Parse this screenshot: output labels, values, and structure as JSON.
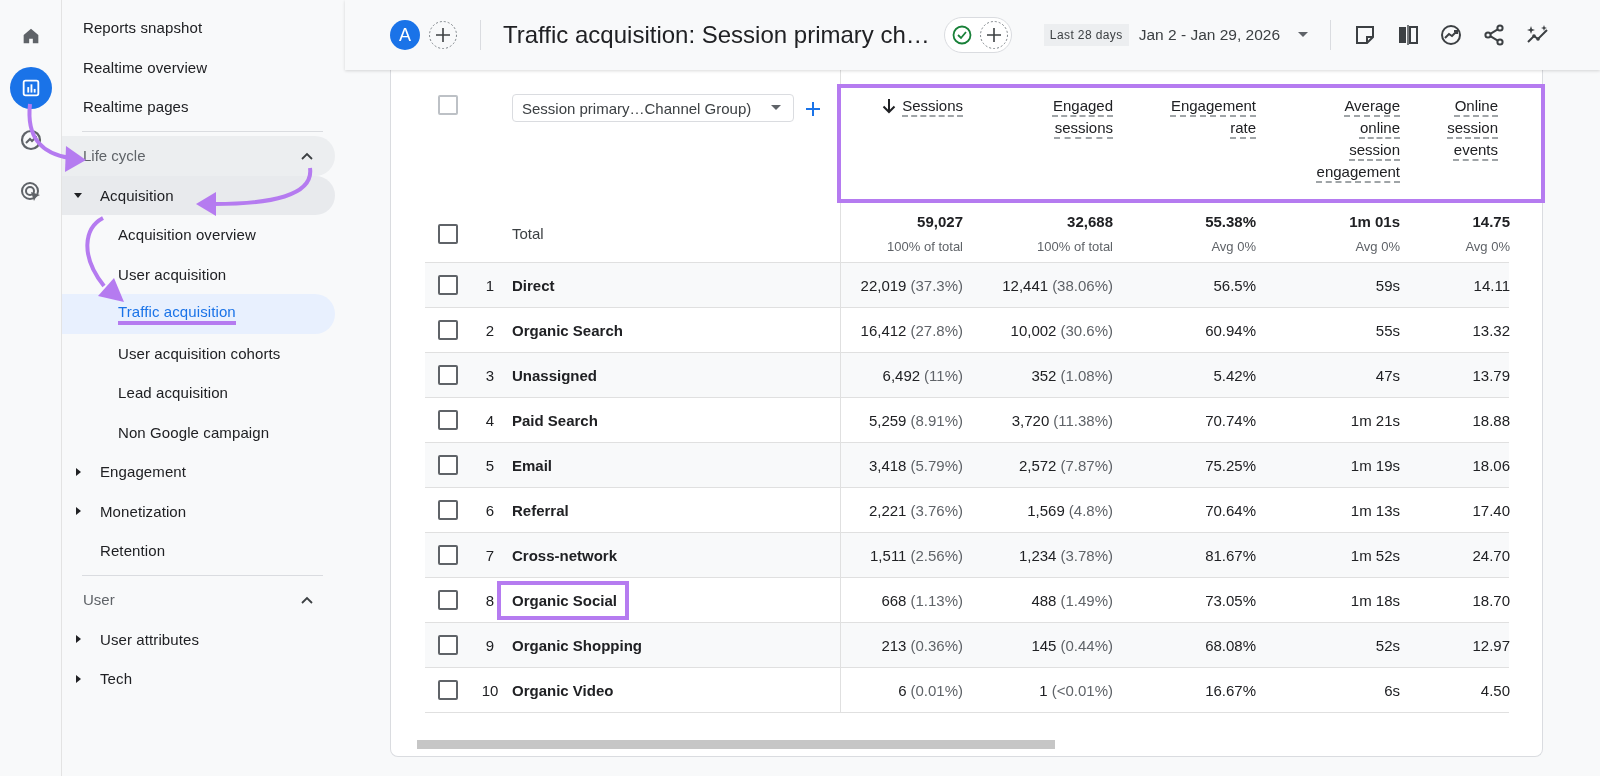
{
  "nav_rail": {
    "items": [
      {
        "kind": "home",
        "selected": false
      },
      {
        "kind": "reports",
        "selected": true
      },
      {
        "kind": "explore",
        "selected": false
      },
      {
        "kind": "advertising",
        "selected": false
      }
    ]
  },
  "sidebar": {
    "top_items": [
      {
        "label": "Reports snapshot",
        "selected": false
      },
      {
        "label": "Realtime overview",
        "selected": false
      },
      {
        "label": "Realtime pages",
        "selected": false
      }
    ],
    "sections": [
      {
        "title": "Life cycle",
        "expanded": true,
        "active": true,
        "items": [
          {
            "label": "Acquisition",
            "expanded": true,
            "children": [
              {
                "label": "Acquisition overview",
                "selected": false,
                "underlined": false
              },
              {
                "label": "User acquisition",
                "selected": false,
                "underlined": false
              },
              {
                "label": "Traffic acquisition",
                "selected": true,
                "underlined": true
              },
              {
                "label": "User acquisition cohorts",
                "selected": false,
                "underlined": false
              },
              {
                "label": "Lead acquisition",
                "selected": false,
                "underlined": false
              },
              {
                "label": "Non Google campaign",
                "selected": false,
                "underlined": false
              }
            ]
          },
          {
            "label": "Engagement",
            "expanded": false
          },
          {
            "label": "Monetization",
            "expanded": false
          },
          {
            "label": "Retention"
          }
        ]
      },
      {
        "title": "User",
        "expanded": true,
        "active": false,
        "items": [
          {
            "label": "User attributes",
            "expanded": false
          },
          {
            "label": "Tech",
            "expanded": false
          }
        ]
      }
    ]
  },
  "topbar": {
    "avatar": "A",
    "title": "Traffic acquisition: Session primary ch…",
    "date_badge": "Last 28 days",
    "date_range": "Jan 2 - Jan 29, 2026"
  },
  "table": {
    "header_checkbox": {
      "checked": false,
      "disabled": true
    },
    "dimension": "Session primary…Channel Group)",
    "columns": [
      {
        "label": "Sessions",
        "sorted": true
      },
      {
        "label": "Engaged sessions",
        "sorted": false
      },
      {
        "label": "Engagement rate",
        "sorted": false
      },
      {
        "label": "Average online session engagement",
        "sorted": false
      },
      {
        "label": "Online session events",
        "sorted": false
      }
    ],
    "columns_highlighted": true,
    "total": {
      "label": "Total",
      "checked": false,
      "values": [
        {
          "value": "59,027",
          "sub": "100% of total"
        },
        {
          "value": "32,688",
          "sub": "100% of total"
        },
        {
          "value": "55.38%",
          "sub": "Avg 0%"
        },
        {
          "value": "1m 01s",
          "sub": "Avg 0%"
        },
        {
          "value": "14.75",
          "sub": "Avg 0%"
        }
      ]
    },
    "rows": [
      {
        "index": "1",
        "name": "Direct",
        "checked": false,
        "highlighted": false,
        "cells": [
          {
            "value": "22,019",
            "share": "(37.3%)"
          },
          {
            "value": "12,441",
            "share": "(38.06%)"
          },
          {
            "value": "56.5%"
          },
          {
            "value": "59s"
          },
          {
            "value": "14.11"
          }
        ]
      },
      {
        "index": "2",
        "name": "Organic Search",
        "checked": false,
        "highlighted": false,
        "cells": [
          {
            "value": "16,412",
            "share": "(27.8%)"
          },
          {
            "value": "10,002",
            "share": "(30.6%)"
          },
          {
            "value": "60.94%"
          },
          {
            "value": "55s"
          },
          {
            "value": "13.32"
          }
        ]
      },
      {
        "index": "3",
        "name": "Unassigned",
        "checked": false,
        "highlighted": false,
        "cells": [
          {
            "value": "6,492",
            "share": "(11%)"
          },
          {
            "value": "352",
            "share": "(1.08%)"
          },
          {
            "value": "5.42%"
          },
          {
            "value": "47s"
          },
          {
            "value": "13.79"
          }
        ]
      },
      {
        "index": "4",
        "name": "Paid Search",
        "checked": false,
        "highlighted": false,
        "cells": [
          {
            "value": "5,259",
            "share": "(8.91%)"
          },
          {
            "value": "3,720",
            "share": "(11.38%)"
          },
          {
            "value": "70.74%"
          },
          {
            "value": "1m 21s"
          },
          {
            "value": "18.88"
          }
        ]
      },
      {
        "index": "5",
        "name": "Email",
        "checked": false,
        "highlighted": false,
        "cells": [
          {
            "value": "3,418",
            "share": "(5.79%)"
          },
          {
            "value": "2,572",
            "share": "(7.87%)"
          },
          {
            "value": "75.25%"
          },
          {
            "value": "1m 19s"
          },
          {
            "value": "18.06"
          }
        ]
      },
      {
        "index": "6",
        "name": "Referral",
        "checked": false,
        "highlighted": false,
        "cells": [
          {
            "value": "2,221",
            "share": "(3.76%)"
          },
          {
            "value": "1,569",
            "share": "(4.8%)"
          },
          {
            "value": "70.64%"
          },
          {
            "value": "1m 13s"
          },
          {
            "value": "17.40"
          }
        ]
      },
      {
        "index": "7",
        "name": "Cross-network",
        "checked": false,
        "highlighted": false,
        "cells": [
          {
            "value": "1,511",
            "share": "(2.56%)"
          },
          {
            "value": "1,234",
            "share": "(3.78%)"
          },
          {
            "value": "81.67%"
          },
          {
            "value": "1m 52s"
          },
          {
            "value": "24.70"
          }
        ]
      },
      {
        "index": "8",
        "name": "Organic Social",
        "checked": false,
        "highlighted": true,
        "cells": [
          {
            "value": "668",
            "share": "(1.13%)"
          },
          {
            "value": "488",
            "share": "(1.49%)"
          },
          {
            "value": "73.05%"
          },
          {
            "value": "1m 18s"
          },
          {
            "value": "18.70"
          }
        ]
      },
      {
        "index": "9",
        "name": "Organic Shopping",
        "checked": false,
        "highlighted": false,
        "cells": [
          {
            "value": "213",
            "share": "(0.36%)"
          },
          {
            "value": "145",
            "share": "(0.44%)"
          },
          {
            "value": "68.08%"
          },
          {
            "value": "52s"
          },
          {
            "value": "12.97"
          }
        ]
      },
      {
        "index": "10",
        "name": "Organic Video",
        "checked": false,
        "highlighted": false,
        "cells": [
          {
            "value": "6",
            "share": "(0.01%)"
          },
          {
            "value": "1",
            "share": "(<0.01%)"
          },
          {
            "value": "16.67%"
          },
          {
            "value": "6s"
          },
          {
            "value": "4.50"
          }
        ]
      }
    ]
  }
}
